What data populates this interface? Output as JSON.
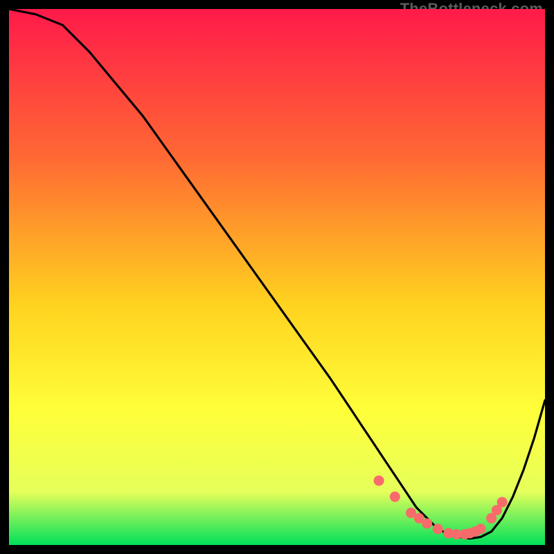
{
  "watermark": "TheBottleneck.com",
  "colors": {
    "gradient_top": "#ff1a4a",
    "gradient_mid1": "#ff6a33",
    "gradient_mid2": "#ffd21f",
    "gradient_mid3": "#ffff3a",
    "gradient_mid4": "#e6ff5a",
    "gradient_bottom": "#00e05a",
    "curve": "#000000",
    "points": "#f76b6b"
  },
  "chart_data": {
    "type": "line",
    "title": "",
    "xlabel": "",
    "ylabel": "",
    "xlim": [
      0,
      100
    ],
    "ylim": [
      0,
      100
    ],
    "series": [
      {
        "name": "bottleneck-curve",
        "x": [
          0,
          5,
          10,
          15,
          20,
          25,
          30,
          35,
          40,
          45,
          50,
          55,
          60,
          62,
          64,
          66,
          68,
          70,
          72,
          74,
          76,
          78,
          80,
          82,
          84,
          86,
          88,
          90,
          92,
          94,
          96,
          98,
          100
        ],
        "y": [
          100,
          99,
          97,
          92,
          86,
          80,
          73,
          66,
          59,
          52,
          45,
          38,
          31,
          28,
          25,
          22,
          19,
          16,
          13,
          10,
          7,
          5,
          3,
          2,
          1.5,
          1.2,
          1.5,
          2.5,
          5,
          9,
          14,
          20,
          27
        ]
      }
    ],
    "scatter_points": {
      "name": "optimal-zone-points",
      "x": [
        69,
        72,
        75,
        76.5,
        78,
        80,
        82,
        83.5,
        85,
        86,
        87,
        88,
        90,
        91,
        92
      ],
      "y": [
        12,
        9,
        6,
        5,
        4,
        3,
        2.2,
        2,
        2,
        2.2,
        2.5,
        3,
        5,
        6.5,
        8
      ]
    }
  }
}
